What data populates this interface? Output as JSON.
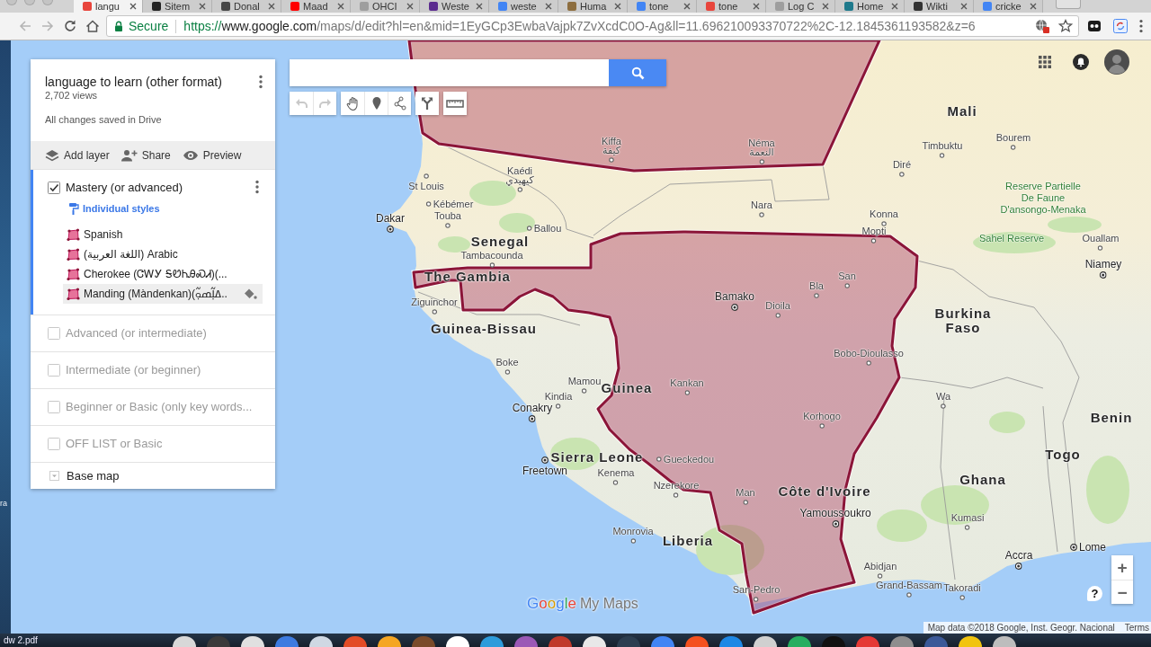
{
  "browser": {
    "tabs": [
      {
        "title": "langu",
        "selected": true,
        "color": "#e8453c"
      },
      {
        "title": "Sitem",
        "selected": false,
        "color": "#222222"
      },
      {
        "title": "Donal",
        "selected": false,
        "color": "#464646"
      },
      {
        "title": "Maad",
        "selected": false,
        "color": "#ff0000"
      },
      {
        "title": "OHCI",
        "selected": false,
        "color": "#9e9e9e"
      },
      {
        "title": "Weste",
        "selected": false,
        "color": "#5b2c8f"
      },
      {
        "title": "weste",
        "selected": false,
        "color": "#4285f4"
      },
      {
        "title": "Huma",
        "selected": false,
        "color": "#8d6e3f"
      },
      {
        "title": "tone",
        "selected": false,
        "color": "#4285f4"
      },
      {
        "title": "tone",
        "selected": false,
        "color": "#e8453c"
      },
      {
        "title": "Log C",
        "selected": false,
        "color": "#9e9e9e"
      },
      {
        "title": "Home",
        "selected": false,
        "color": "#1f7a8c"
      },
      {
        "title": "Wikti",
        "selected": false,
        "color": "#333333"
      },
      {
        "title": "cricke",
        "selected": false,
        "color": "#4285f4"
      }
    ],
    "address_bar": {
      "security": "Secure",
      "url": {
        "scheme": "https://",
        "host": "www.google.com",
        "path": "/maps/d/edit?hl=en&mid=1EyGCp3EwbaVajpk7ZvXcdC0O-Ag&ll=11.696210093370722%2C-12.1845361193582&z=6"
      }
    }
  },
  "panel": {
    "title": "language to learn (other format)",
    "views": "2,702 views",
    "save_status": "All changes saved in Drive",
    "actions": [
      {
        "kind": "add-layer",
        "label": "Add layer"
      },
      {
        "kind": "share",
        "label": "Share"
      },
      {
        "kind": "preview",
        "label": "Preview"
      }
    ],
    "layers": [
      {
        "title": "Mastery (or advanced)",
        "checked": true,
        "selected": true,
        "style_label": "Individual styles",
        "items": [
          {
            "label": "Spanish",
            "selected": false
          },
          {
            "label": "(اللغة العربية) Arabic",
            "selected": false
          },
          {
            "label": "Cherokee (ᏣᎳᎩ ᎦᏬᏂᎯᏍᏗ)(...",
            "selected": false
          },
          {
            "label": "Manding (Màndenkan)(ߡߊ߲߬ߘߋ߲߬..",
            "selected": true
          }
        ]
      },
      {
        "title": "Advanced (or intermediate)",
        "checked": false,
        "selected": false
      },
      {
        "title": "Intermediate (or beginner)",
        "checked": false,
        "selected": false
      },
      {
        "title": "Beginner or Basic (only key words...",
        "checked": false,
        "selected": false
      },
      {
        "title": "OFF LIST or Basic",
        "checked": false,
        "selected": false
      }
    ],
    "base_map": {
      "label": "Base map"
    }
  },
  "map": {
    "tools": [
      {
        "kind": "undo",
        "disabled": true
      },
      {
        "kind": "redo",
        "disabled": true
      },
      {
        "kind": "pan",
        "disabled": false
      },
      {
        "kind": "marker",
        "disabled": false
      },
      {
        "kind": "line",
        "disabled": false
      },
      {
        "kind": "directions",
        "disabled": false
      },
      {
        "kind": "measure",
        "disabled": false
      }
    ],
    "labels": [
      {
        "text": "Mali",
        "kind": "country"
      },
      {
        "text": "Senegal",
        "kind": "country"
      },
      {
        "text": "The Gambia",
        "kind": "country"
      },
      {
        "text": "Guinea-Bissau",
        "kind": "country"
      },
      {
        "text": "Guinea",
        "kind": "country"
      },
      {
        "text": "Sierra Leone",
        "kind": "country"
      },
      {
        "text": "Liberia",
        "kind": "country"
      },
      {
        "text": "Côte d'Ivoire",
        "kind": "country"
      },
      {
        "text": "Burkina Faso",
        "kind": "country"
      },
      {
        "text": "Ghana",
        "kind": "country"
      },
      {
        "text": "Togo",
        "kind": "country"
      },
      {
        "text": "Benin",
        "kind": "country"
      },
      {
        "text": "Kiffa",
        "kind": "label"
      },
      {
        "text": "كيفة",
        "kind": "city"
      },
      {
        "text": "Néma",
        "kind": "label"
      },
      {
        "text": "النعمة",
        "kind": "city"
      },
      {
        "text": "Timbuktu",
        "kind": "city"
      },
      {
        "text": "Bourem",
        "kind": "city"
      },
      {
        "text": "Diré",
        "kind": "city"
      },
      {
        "text": "Kaédi",
        "kind": "label"
      },
      {
        "text": "كيهيدي",
        "kind": "city"
      },
      {
        "text": "St Louis",
        "kind": "city"
      },
      {
        "text": "Kébémer",
        "kind": "city"
      },
      {
        "text": "Dakar",
        "kind": "capital"
      },
      {
        "text": "Touba",
        "kind": "city"
      },
      {
        "text": "Ballou",
        "kind": "city"
      },
      {
        "text": "Nara",
        "kind": "city"
      },
      {
        "text": "Konna",
        "kind": "city"
      },
      {
        "text": "Mopti",
        "kind": "city"
      },
      {
        "text": "Reserve Partielle De Faune D'ansongo-Menaka",
        "kind": "park"
      },
      {
        "text": "Sahel Reserve",
        "kind": "park"
      },
      {
        "text": "Ouallam",
        "kind": "city"
      },
      {
        "text": "Niamey",
        "kind": "capital"
      },
      {
        "text": "Tambacounda",
        "kind": "city"
      },
      {
        "text": "Ziguinchor",
        "kind": "city"
      },
      {
        "text": "Bamako",
        "kind": "capital"
      },
      {
        "text": "Dioila",
        "kind": "city"
      },
      {
        "text": "San",
        "kind": "city"
      },
      {
        "text": "Bla",
        "kind": "city"
      },
      {
        "text": "Bobo-Dioulasso",
        "kind": "city"
      },
      {
        "text": "Boke",
        "kind": "city"
      },
      {
        "text": "Mamou",
        "kind": "city"
      },
      {
        "text": "Kindia",
        "kind": "city"
      },
      {
        "text": "Conakry",
        "kind": "capital"
      },
      {
        "text": "Kankan",
        "kind": "city"
      },
      {
        "text": "Korhogo",
        "kind": "city"
      },
      {
        "text": "Freetown",
        "kind": "capital"
      },
      {
        "text": "Gueckedou",
        "kind": "city"
      },
      {
        "text": "Kenema",
        "kind": "city"
      },
      {
        "text": "Nzerekore",
        "kind": "city"
      },
      {
        "text": "Man",
        "kind": "city"
      },
      {
        "text": "Yamoussoukro",
        "kind": "capital"
      },
      {
        "text": "Wa",
        "kind": "city"
      },
      {
        "text": "Kumasi",
        "kind": "city"
      },
      {
        "text": "Monrovia",
        "kind": "city"
      },
      {
        "text": "Abidjan",
        "kind": "city"
      },
      {
        "text": "Grand-Bassam",
        "kind": "city"
      },
      {
        "text": "San-Pedro",
        "kind": "city"
      },
      {
        "text": "Accra",
        "kind": "capital"
      },
      {
        "text": "Lome",
        "kind": "capital"
      },
      {
        "text": "Takoradi",
        "kind": "city"
      }
    ],
    "zoom_in": "+",
    "zoom_out": "−",
    "help": "?",
    "logo": {
      "brand": "Google",
      "product": "My Maps"
    },
    "attribution": "Map data ©2018 Google, Inst. Geogr. Nacional",
    "terms": "Terms"
  },
  "desktop": {
    "edge_label": "ra",
    "file_label": "dw 2.pdf"
  }
}
